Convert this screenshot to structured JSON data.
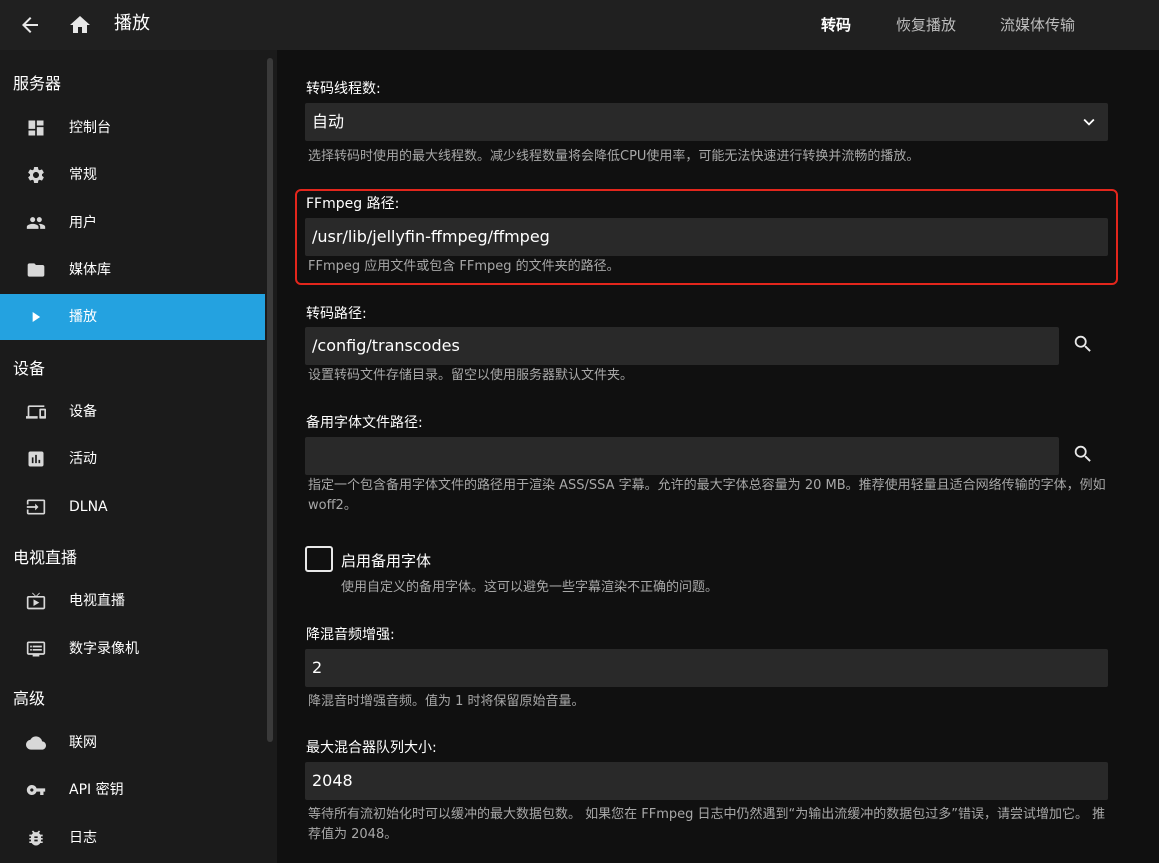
{
  "header": {
    "title": "播放",
    "tabs": [
      {
        "label": "转码",
        "active": true
      },
      {
        "label": "恢复播放",
        "active": false
      },
      {
        "label": "流媒体传输",
        "active": false
      }
    ]
  },
  "sidebar": {
    "sections": [
      {
        "heading": "服务器",
        "items": [
          {
            "label": "控制台",
            "icon": "dashboard-icon"
          },
          {
            "label": "常规",
            "icon": "gear-icon"
          },
          {
            "label": "用户",
            "icon": "people-icon"
          },
          {
            "label": "媒体库",
            "icon": "folder-icon"
          },
          {
            "label": "播放",
            "icon": "play-icon",
            "active": true
          }
        ]
      },
      {
        "heading": "设备",
        "items": [
          {
            "label": "设备",
            "icon": "devices-icon"
          },
          {
            "label": "活动",
            "icon": "chart-icon"
          },
          {
            "label": "DLNA",
            "icon": "input-icon"
          }
        ]
      },
      {
        "heading": "电视直播",
        "items": [
          {
            "label": "电视直播",
            "icon": "live-tv-icon"
          },
          {
            "label": "数字录像机",
            "icon": "dvr-icon"
          }
        ]
      },
      {
        "heading": "高级",
        "items": [
          {
            "label": "联网",
            "icon": "cloud-icon"
          },
          {
            "label": "API 密钥",
            "icon": "key-icon"
          },
          {
            "label": "日志",
            "icon": "bug-icon"
          }
        ]
      }
    ]
  },
  "form": {
    "threads": {
      "label": "转码线程数:",
      "value": "自动",
      "desc": "选择转码时使用的最大线程数。减少线程数量将会降低CPU使用率，可能无法快速进行转换并流畅的播放。"
    },
    "ffmpeg": {
      "label": "FFmpeg 路径:",
      "value": "/usr/lib/jellyfin-ffmpeg/ffmpeg",
      "desc": "FFmpeg 应用文件或包含 FFmpeg 的文件夹的路径。"
    },
    "transcode_path": {
      "label": "转码路径:",
      "value": "/config/transcodes",
      "desc": "设置转码文件存储目录。留空以使用服务器默认文件夹。"
    },
    "fallback_font_path": {
      "label": "备用字体文件路径:",
      "value": "",
      "desc": "指定一个包含备用字体文件的路径用于渲染 ASS/SSA 字幕。允许的最大字体总容量为 20 MB。推荐使用轻量且适合网络传输的字体，例如 woff2。"
    },
    "enable_fallback_font": {
      "label": "启用备用字体",
      "checked": false,
      "desc": "使用自定义的备用字体。这可以避免一些字幕渲染不正确的问题。"
    },
    "downmix_boost": {
      "label": "降混音频增强:",
      "value": "2",
      "desc": "降混音时增强音频。值为 1 时将保留原始音量。"
    },
    "max_muxing_queue": {
      "label": "最大混合器队列大小:",
      "value": "2048",
      "desc": "等待所有流初始化时可以缓冲的最大数据包数。 如果您在 FFmpeg 日志中仍然遇到“为输出流缓冲的数据包过多”错误，请尝试增加它。 推荐值为 2048。"
    }
  },
  "colors": {
    "accent": "#24a2e0",
    "highlight_border": "#e3261c"
  }
}
